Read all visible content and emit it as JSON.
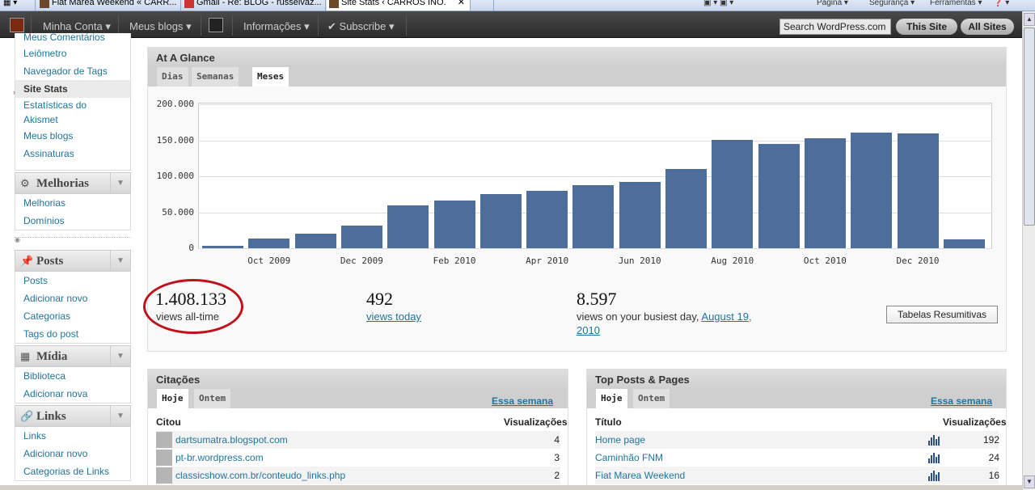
{
  "browser_tabs": [
    {
      "label": "Fiat Marea Weekend « CARR..."
    },
    {
      "label": "Gmail - Re: BLOG - russelvaz..."
    },
    {
      "label": "Site Stats ‹ CARROS INO..."
    }
  ],
  "browser_controls": [
    "Página",
    "Segurança",
    "Ferramentas"
  ],
  "adminbar": {
    "minha_conta": "Minha Conta",
    "meus_blogs": "Meus blogs",
    "informacoes": "Informações",
    "subscribe": "Subscribe",
    "search": "Search WordPress.com",
    "this_site": "This Site",
    "all_sites": "All Sites"
  },
  "sidebar": {
    "top_items": [
      "Meus Comentários",
      "Leiômetro",
      "Navegador de Tags",
      "Site Stats",
      "Estatísticas do",
      "Akismet",
      "Meus blogs",
      "Assinaturas"
    ],
    "melhorias": {
      "title": "Melhorias",
      "items": [
        "Melhorias",
        "Domínios"
      ]
    },
    "posts": {
      "title": "Posts",
      "items": [
        "Posts",
        "Adicionar novo",
        "Categorias",
        "Tags do post"
      ]
    },
    "midia": {
      "title": "Mídia",
      "items": [
        "Biblioteca",
        "Adicionar nova"
      ]
    },
    "links": {
      "title": "Links",
      "items": [
        "Links",
        "Adicionar novo",
        "Categorias de Links"
      ]
    }
  },
  "glance": {
    "title": "At A Glance",
    "tabs": [
      "Dias",
      "Semanas",
      "Meses"
    ],
    "active_tab": "Meses",
    "views_all_time": "1.408.133",
    "views_all_time_label": "views all-time",
    "views_today": "492",
    "views_today_label": "views today",
    "busiest": "8.597",
    "busiest_label": "views on your busiest day,",
    "busiest_date_1": "August 19,",
    "busiest_date_2": "2010",
    "summary_button": "Tabelas Resumitivas"
  },
  "chart_data": {
    "type": "bar",
    "title": "",
    "xlabel": "",
    "ylabel": "",
    "ylim": [
      0,
      200000
    ],
    "y_ticks": [
      "200.000",
      "150.000",
      "100.000",
      "50.000",
      "0"
    ],
    "x_tick_labels": [
      "Oct 2009",
      "Dec 2009",
      "Feb 2010",
      "Apr 2010",
      "Jun 2010",
      "Aug 2010",
      "Oct 2010",
      "Dec 2010"
    ],
    "categories": [
      "Sep 2009",
      "Oct 2009",
      "Nov 2009",
      "Dec 2009",
      "Jan 2010",
      "Feb 2010",
      "Mar 2010",
      "Apr 2010",
      "May 2010",
      "Jun 2010",
      "Jul 2010",
      "Aug 2010",
      "Sep 2010",
      "Oct 2010",
      "Nov 2010",
      "Dec 2010",
      "Jan 2011"
    ],
    "values": [
      3000,
      13000,
      20000,
      32000,
      60000,
      66000,
      75000,
      80000,
      88000,
      92000,
      110000,
      151000,
      145000,
      153000,
      161000,
      159000,
      12000
    ],
    "grid": true
  },
  "citacoes": {
    "title": "Citações",
    "tabs": [
      "Hoje",
      "Ontem"
    ],
    "link": "Essa semana",
    "col1": "Citou",
    "col2": "Visualizações",
    "rows": [
      {
        "name": "dartsumatra.blogspot.com",
        "value": "4"
      },
      {
        "name": "pt-br.wordpress.com",
        "value": "3"
      },
      {
        "name": "classicshow.com.br/conteudo_links.php",
        "value": "2"
      }
    ]
  },
  "top_posts": {
    "title": "Top Posts & Pages",
    "tabs": [
      "Hoje",
      "Ontem"
    ],
    "link": "Essa semana",
    "col1": "Título",
    "col2": "Visualizações",
    "rows": [
      {
        "name": "Home page",
        "value": "192"
      },
      {
        "name": "Caminhão FNM",
        "value": "24"
      },
      {
        "name": "Fiat Marea Weekend",
        "value": "16"
      }
    ]
  }
}
